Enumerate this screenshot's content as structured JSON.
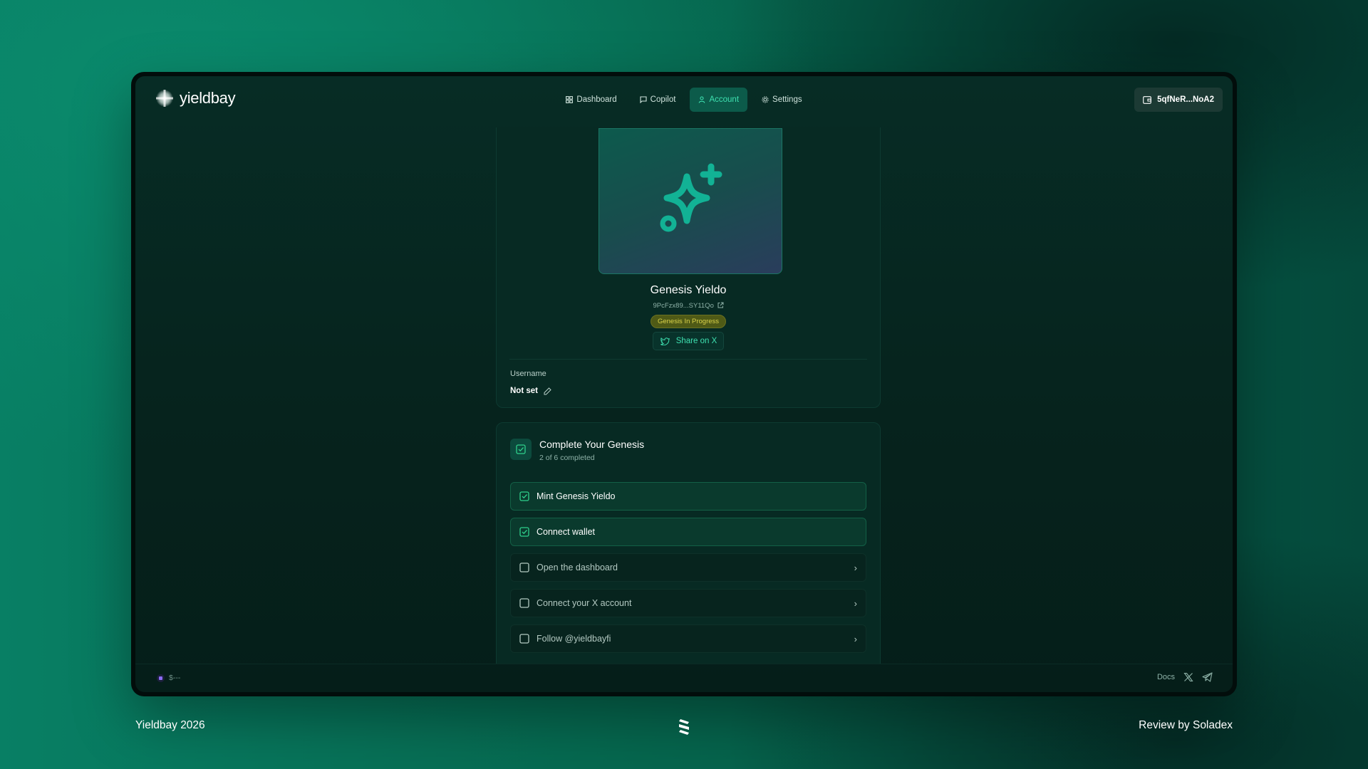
{
  "header": {
    "logo_text": "yieldbay",
    "nav": [
      {
        "label": "Dashboard",
        "icon": "grid-icon",
        "active": false
      },
      {
        "label": "Copilot",
        "icon": "chat-icon",
        "active": false
      },
      {
        "label": "Account",
        "icon": "user-icon",
        "active": true
      },
      {
        "label": "Settings",
        "icon": "gear-icon",
        "active": false
      }
    ],
    "wallet_label": "5qfNeR...NoA2"
  },
  "profile": {
    "nft_title": "Genesis Yieldo",
    "address": "9PcFzx89...SY11Qo",
    "status_badge": "Genesis In Progress",
    "share_label": "Share on X",
    "username_label": "Username",
    "username_value": "Not set"
  },
  "genesis": {
    "title": "Complete Your Genesis",
    "progress": "2 of 6 completed",
    "progress_done": 2,
    "progress_total": 6,
    "tasks": [
      {
        "label": "Mint Genesis Yieldo",
        "done": true
      },
      {
        "label": "Connect wallet",
        "done": true
      },
      {
        "label": "Open the dashboard",
        "done": false
      },
      {
        "label": "Connect your X account",
        "done": false
      },
      {
        "label": "Follow @yieldbayfi",
        "done": false
      }
    ]
  },
  "status_bar": {
    "price": "$---",
    "docs_label": "Docs"
  },
  "page_footer": {
    "left": "Yieldbay 2026",
    "right": "Review by Soladex"
  },
  "colors": {
    "accent": "#3ee0b0",
    "badge_bg": "#4f5a16",
    "badge_text": "#d9d24a",
    "background": "#072c25"
  }
}
